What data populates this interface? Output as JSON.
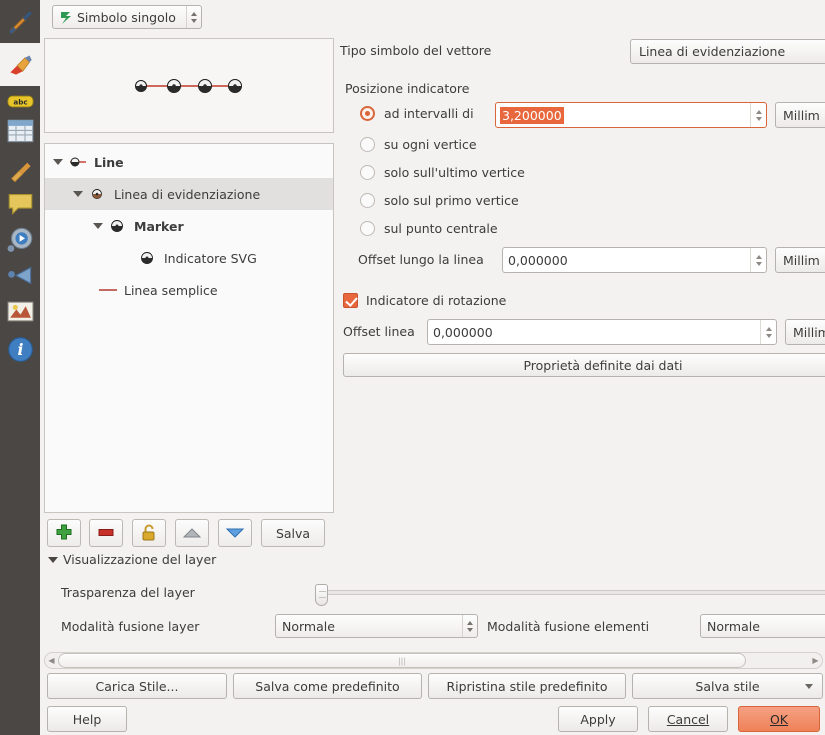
{
  "sidebar": {
    "items": [
      {
        "name": "general-properties",
        "icon": "hammer-wrench-icon",
        "selected": false
      },
      {
        "name": "style",
        "icon": "paintbrush-icon",
        "selected": true
      },
      {
        "name": "labels",
        "icon": "abc-label-icon",
        "selected": false
      },
      {
        "name": "fields",
        "icon": "table-fields-icon",
        "selected": false
      },
      {
        "name": "rendering",
        "icon": "broom-icon",
        "selected": false
      },
      {
        "name": "display",
        "icon": "speech-balloon-icon",
        "selected": false
      },
      {
        "name": "actions",
        "icon": "gear-play-icon",
        "selected": false
      },
      {
        "name": "joins",
        "icon": "funnel-icon",
        "selected": false
      },
      {
        "name": "diagrams",
        "icon": "diagram-image-icon",
        "selected": false
      },
      {
        "name": "metadata",
        "icon": "info-icon",
        "selected": false
      }
    ]
  },
  "renderer": {
    "combo_value": "Simbolo singolo",
    "combo_icon": "single-symbol-icon"
  },
  "preview": {
    "line_color": "#c0392b",
    "marker_count": 4
  },
  "tree": {
    "nodes": [
      {
        "label": "Line",
        "icon": "line-symbol-icon",
        "indent": 0,
        "bold": true,
        "expanded": true,
        "selected": false
      },
      {
        "label": "Linea di evidenziazione",
        "icon": "hashline-icon",
        "indent": 1,
        "bold": false,
        "expanded": true,
        "selected": true
      },
      {
        "label": "Marker",
        "icon": "marker-svg-icon",
        "indent": 2,
        "bold": true,
        "expanded": true,
        "selected": false
      },
      {
        "label": "Indicatore SVG",
        "icon": "marker-svg-icon",
        "indent": 3,
        "bold": false,
        "expanded": false,
        "selected": false
      },
      {
        "label": "Linea semplice",
        "icon": "simple-line-icon",
        "indent": 1,
        "bold": false,
        "expanded": false,
        "selected": false
      }
    ]
  },
  "tree_toolbar": {
    "add_label": "add-symbol-layer",
    "remove_label": "remove-symbol-layer",
    "lock_label": "lock-layer-colors",
    "up_label": "move-up",
    "down_label": "move-down",
    "save_label": "Salva"
  },
  "layer_rendering": {
    "section_title": "Visualizzazione del layer",
    "transparency_label": "Trasparenza del layer",
    "transparency_value": 0,
    "layer_blend_label": "Modalità fusione layer",
    "layer_blend_value": "Normale",
    "feature_blend_label": "Modalità fusione elementi",
    "feature_blend_value": "Normale"
  },
  "properties": {
    "symbol_type_label": "Tipo simbolo del vettore",
    "symbol_type_value": "Linea di evidenziazione",
    "marker_position_label": "Posizione indicatore",
    "radios": [
      {
        "label": "ad intervalli di",
        "selected": true
      },
      {
        "label": "su ogni vertice",
        "selected": false
      },
      {
        "label": "solo sull'ultimo vertice",
        "selected": false
      },
      {
        "label": "solo sul primo vertice",
        "selected": false
      },
      {
        "label": "sul punto centrale",
        "selected": false
      }
    ],
    "interval_value": "3,200000",
    "interval_unit": "Millim",
    "offset_along_line_label": "Offset lungo la linea",
    "offset_along_line_value": "0,000000",
    "offset_along_line_unit": "Millim",
    "rotate_marker_label": "Indicatore di rotazione",
    "rotate_marker_checked": true,
    "line_offset_label": "Offset linea",
    "line_offset_value": "0,000000",
    "line_offset_unit": "Millim",
    "data_defined_label": "Proprietà definite dai dati"
  },
  "style_buttons": {
    "load": "Carica Stile...",
    "save_default": "Salva come predefinito",
    "restore_default": "Ripristina stile predefinito",
    "save_style": "Salva stile"
  },
  "dialog_buttons": {
    "help": "Help",
    "apply": "Apply",
    "cancel": "Cancel",
    "ok": "OK"
  },
  "accent": {
    "orange": "#e8673c",
    "ok_button": "#ef8159",
    "selection_gray": "#e2e0de"
  }
}
